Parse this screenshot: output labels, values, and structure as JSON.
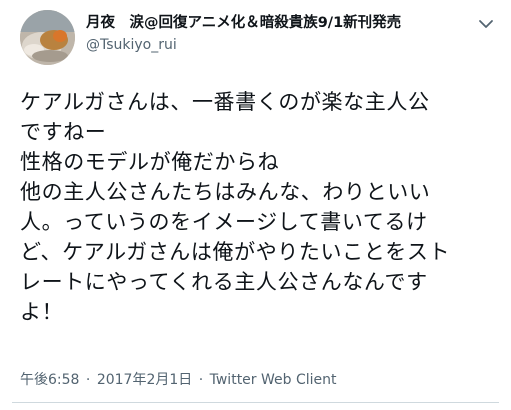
{
  "tweet": {
    "author": {
      "display_name": "月夜　涙@回復アニメ化＆暗殺貴族9/1新刊発売",
      "handle": "@Tsukiyo_rui",
      "avatar": "profile-photo"
    },
    "menu_icon": "chevron-down-icon",
    "text_lines": [
      "ケアルガさんは、一番書くのが楽な主人公",
      "ですねー",
      "性格のモデルが俺だからね",
      "他の主人公さんたちはみんな、わりといい",
      "人。っていうのをイメージして書いてるけ",
      "ど、ケアルガさんは俺がやりたいことをスト",
      "レートにやってくれる主人公さんなんです",
      "よ！"
    ],
    "time": "午後6:58",
    "separator": "·",
    "date": "2017年2月1日",
    "client": "Twitter Web Client"
  }
}
